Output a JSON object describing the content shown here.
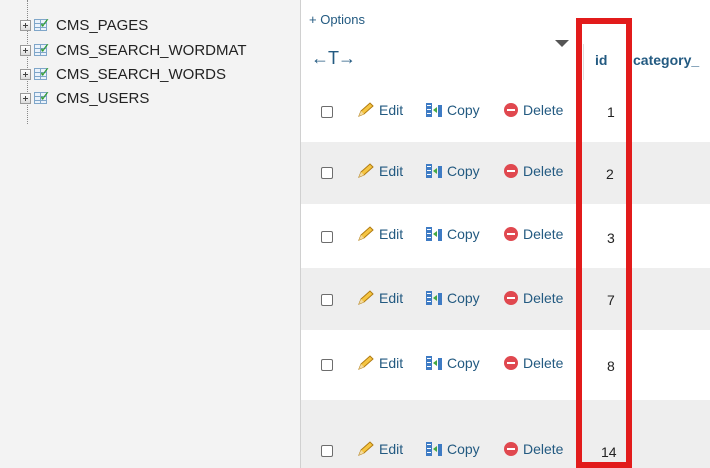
{
  "navigation": {
    "tables": [
      {
        "name": "CMS_PAGES"
      },
      {
        "name": "CMS_SEARCH_WORDMAT"
      },
      {
        "name": "CMS_SEARCH_WORDS"
      },
      {
        "name": "CMS_USERS"
      }
    ]
  },
  "main": {
    "options_link": "+ Options",
    "column_resizer": "←T→",
    "columns": [
      "id",
      "category_"
    ],
    "actions": {
      "edit_label": "Edit",
      "copy_label": "Copy",
      "delete_label": "Delete"
    },
    "rows": [
      {
        "id": "1"
      },
      {
        "id": "2"
      },
      {
        "id": "3"
      },
      {
        "id": "7"
      },
      {
        "id": "8"
      },
      {
        "id": "14"
      }
    ]
  },
  "colors": {
    "highlight": "#e21b1b",
    "link": "#235a81",
    "row_alt": "#eeeeee",
    "nav_bg": "#f3f3f3"
  }
}
